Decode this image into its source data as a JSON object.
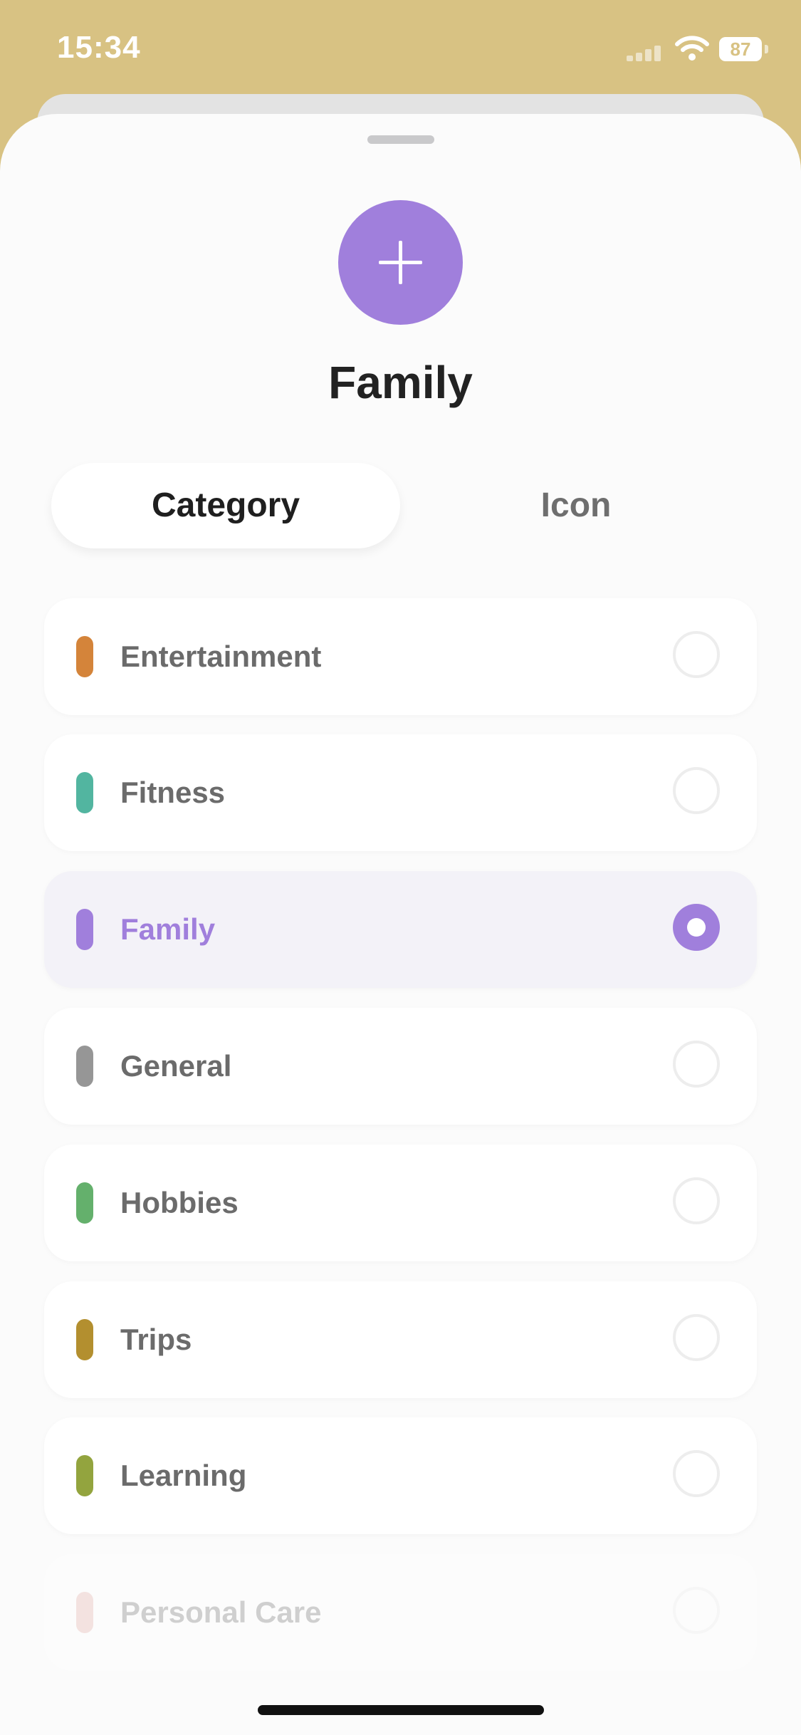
{
  "status_bar": {
    "time": "15:34",
    "battery": "87",
    "icons": [
      "signal-icon",
      "wifi-icon",
      "battery-icon"
    ]
  },
  "sheet": {
    "add_icon": "plus-icon",
    "accent_color": "#a07fdc",
    "title": "Family"
  },
  "segments": {
    "active": "Category",
    "inactive": "Icon"
  },
  "categories": [
    {
      "label": "Entertainment",
      "color": "#d4843a",
      "selected": false
    },
    {
      "label": "Fitness",
      "color": "#52b5a0",
      "selected": false
    },
    {
      "label": "Family",
      "color": "#a07fdc",
      "selected": true
    },
    {
      "label": "General",
      "color": "#969696",
      "selected": false
    },
    {
      "label": "Hobbies",
      "color": "#64b06c",
      "selected": false
    },
    {
      "label": "Trips",
      "color": "#b38f2f",
      "selected": false
    },
    {
      "label": "Learning",
      "color": "#93a43e",
      "selected": false
    },
    {
      "label": "Personal Care",
      "color": "#e2aaa3",
      "selected": false
    }
  ]
}
